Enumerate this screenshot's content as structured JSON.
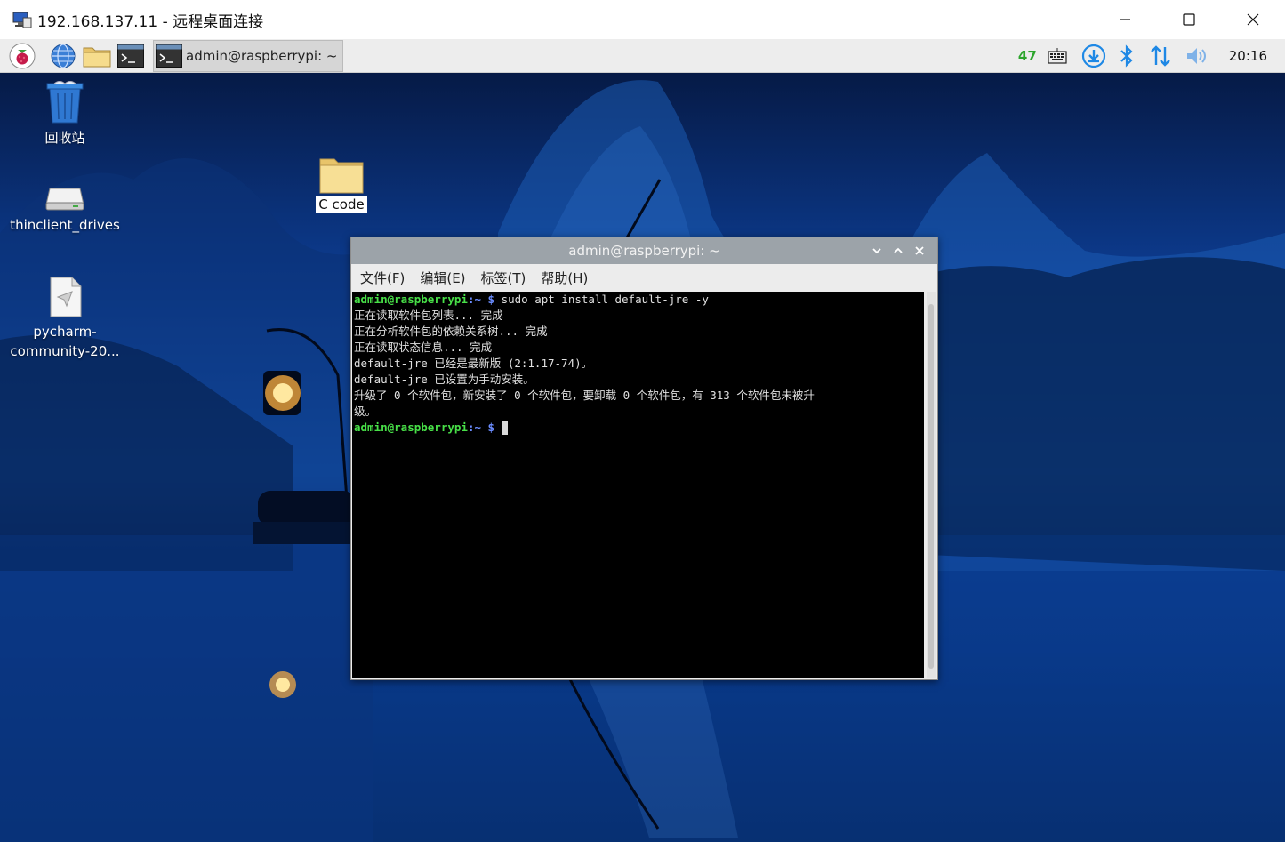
{
  "rdp": {
    "title": "192.168.137.11 - 远程桌面连接"
  },
  "taskbar": {
    "task_label": "admin@raspberrypi: ~",
    "cpu": "47",
    "clock": "20:16"
  },
  "desktop": {
    "icons": [
      {
        "label": "回收站"
      },
      {
        "label": "thinclient_drives"
      },
      {
        "label": "pycharm-community-20..."
      }
    ],
    "folder": {
      "label": "C code"
    }
  },
  "terminal": {
    "title": "admin@raspberrypi: ~",
    "menus": [
      "文件(F)",
      "编辑(E)",
      "标签(T)",
      "帮助(H)"
    ],
    "prompt_user": "admin@raspberrypi",
    "prompt_path": ":~ $",
    "command": " sudo apt install default-jre -y",
    "output": [
      "正在读取软件包列表... 完成",
      "正在分析软件包的依赖关系树... 完成",
      "正在读取状态信息... 完成",
      "default-jre 已经是最新版 (2:1.17-74)。",
      "default-jre 已设置为手动安装。",
      "升级了 0 个软件包，新安装了 0 个软件包，要卸载 0 个软件包，有 313 个软件包未被升",
      "级。"
    ]
  }
}
